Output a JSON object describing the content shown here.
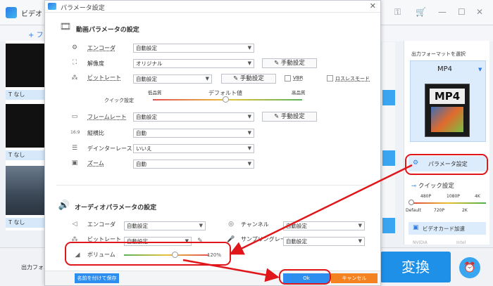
{
  "app": {
    "title": "ビデオ",
    "add_label": "+ フ",
    "subtitle_none": "なし",
    "output_folder_label": "出力フォル",
    "convert_label": "変換",
    "right_panel": {
      "format_header": "出力フォーマットを選択",
      "format_name": "MP4",
      "format_icon_text": "MP4",
      "param_button": "パラメータ設定",
      "quick_label": "クイック設定",
      "quick_ticks_top": [
        "480P",
        "1080P",
        "4K"
      ],
      "quick_ticks_bottom": [
        "Default",
        "720P",
        "2K"
      ],
      "gpu_label": "ビデオカード加速",
      "nvidia": "NVIDIA",
      "intel": "Intel"
    }
  },
  "dialog": {
    "title": "パラメータ設定",
    "video_section_title": "動画パラメータの設定",
    "audio_section_title": "オーディオパラメータの設定",
    "video": {
      "encoder_label": "エンコーダ",
      "encoder_value": "自動設定",
      "resolution_label": "解像度",
      "resolution_value": "オリジナル",
      "bitrate_label": "ビットレート",
      "bitrate_value": "自動設定",
      "manual_label": "手動設定",
      "vbr_label": "VBR",
      "lossless_label": "ロスレスモード",
      "quick_label": "クイック設定",
      "quality_low": "低品質",
      "quality_default": "デフォルト値",
      "quality_high": "高品質",
      "framerate_label": "フレームレート",
      "framerate_value": "自動設定",
      "aspect_label": "縦横比",
      "aspect_value": "自動",
      "deinterlace_label": "デインターレース",
      "deinterlace_value": "いいえ",
      "zoom_label": "ズーム",
      "zoom_value": "自動"
    },
    "audio": {
      "encoder_label": "エンコーダ",
      "encoder_value": "自動設定",
      "channel_label": "チャンネル",
      "channel_value": "自動設定",
      "bitrate_label": "ビットレート",
      "bitrate_value": "自動設定",
      "samplerate_label": "サンプリングレート",
      "samplerate_value": "自動設定",
      "volume_label": "ボリューム",
      "volume_value": "120%",
      "volume_level_percent": 120
    },
    "save_as_label": "名前を付けて保存",
    "ok_label": "Ok",
    "cancel_label": "キャンセル"
  },
  "colors": {
    "accent": "#2d8ef0",
    "cancel": "#f58220",
    "highlight": "#e0161b",
    "convert": "#1e90e8"
  }
}
